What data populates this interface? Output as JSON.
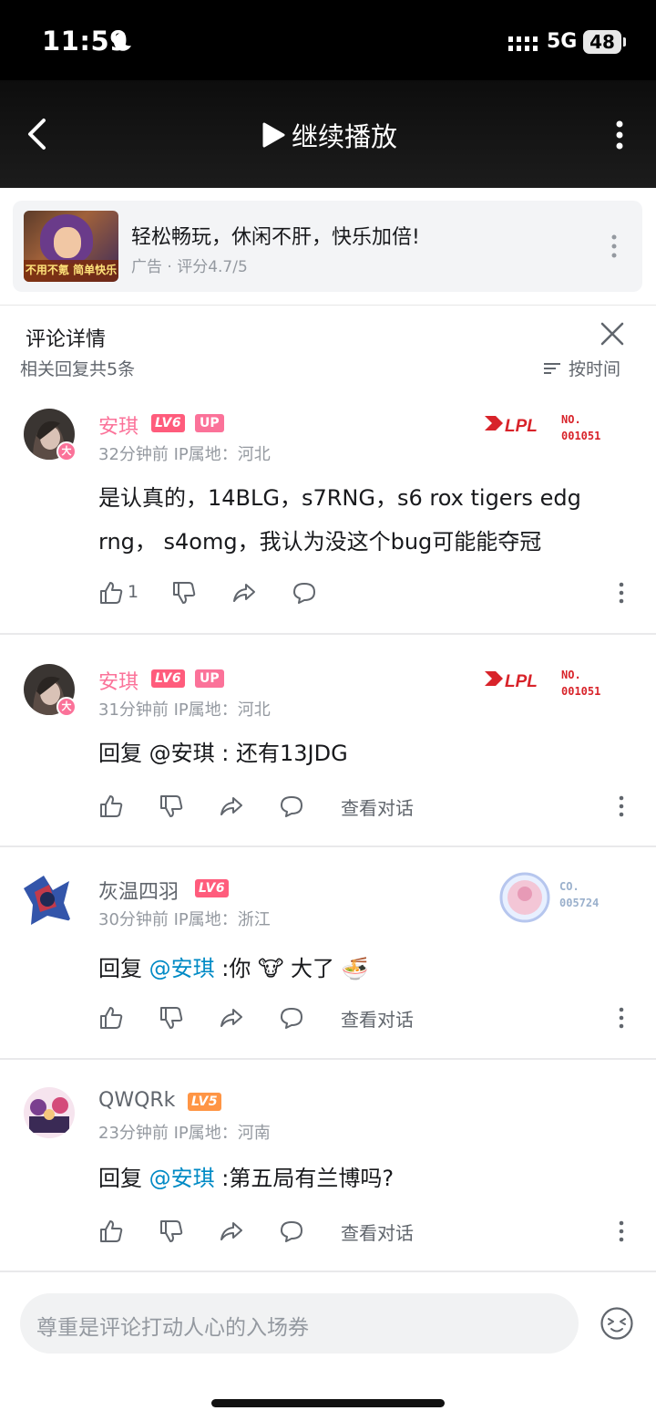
{
  "status_bar": {
    "time": "11:59",
    "network": "5G",
    "battery": "48"
  },
  "video_header": {
    "play_label": "继续播放"
  },
  "ad": {
    "title": "轻松畅玩，休闲不肝，快乐加倍!",
    "meta": "广告 · 评分4.7/5",
    "thumb_caption": "不用不氪 简单快乐"
  },
  "panel": {
    "title": "评论详情",
    "reply_count": "相关回复共5条",
    "sort_label": "按时间"
  },
  "comments": [
    {
      "name": "安琪",
      "level": "LV6",
      "up_tag": "UP",
      "time": "32分钟前  IP属地：河北",
      "text": "是认真的，14BLG，s7RNG，s6 rox tigers edg rng， s4omg，我认为没这个bug可能能夺冠",
      "likes": "1",
      "badge_text": "LPL",
      "badge_no_label": "NO.",
      "badge_no": "001051",
      "avatar_badge": "大"
    },
    {
      "name": "安琪",
      "level": "LV6",
      "up_tag": "UP",
      "time": "31分钟前  IP属地：河北",
      "text": "回复 @安琪 : 还有13JDG",
      "view_conversation": "查看对话",
      "badge_text": "LPL",
      "badge_no_label": "NO.",
      "badge_no": "001051",
      "avatar_badge": "大"
    },
    {
      "name": "灰温四羽",
      "level": "LV6",
      "time": "30分钟前  IP属地：浙江",
      "text_prefix": "回复 ",
      "mention": "@安琪",
      "text_suffix": " :你 🐮 大了 🍜",
      "view_conversation": "查看对话",
      "badge_label": "CO.",
      "badge_no": "005724"
    },
    {
      "name": "QWQRk",
      "level": "LV5",
      "time": "23分钟前  IP属地：河南",
      "text_prefix": "回复 ",
      "mention": "@安琪",
      "text_suffix": " :第五局有兰博吗?",
      "view_conversation": "查看对话"
    }
  ],
  "input": {
    "placeholder": "尊重是评论打动人心的入场券"
  },
  "colors": {
    "pink": "#fb7299",
    "mention": "#008ac5",
    "level6": "#ff5c7c",
    "level5": "#ff9545",
    "lpl_red": "#d8232a"
  },
  "icons": [
    "back-icon",
    "play-icon",
    "more-vertical-icon",
    "close-icon",
    "sort-icon",
    "thumbs-up-icon",
    "thumbs-down-icon",
    "share-icon",
    "comment-icon",
    "emoji-icon"
  ]
}
